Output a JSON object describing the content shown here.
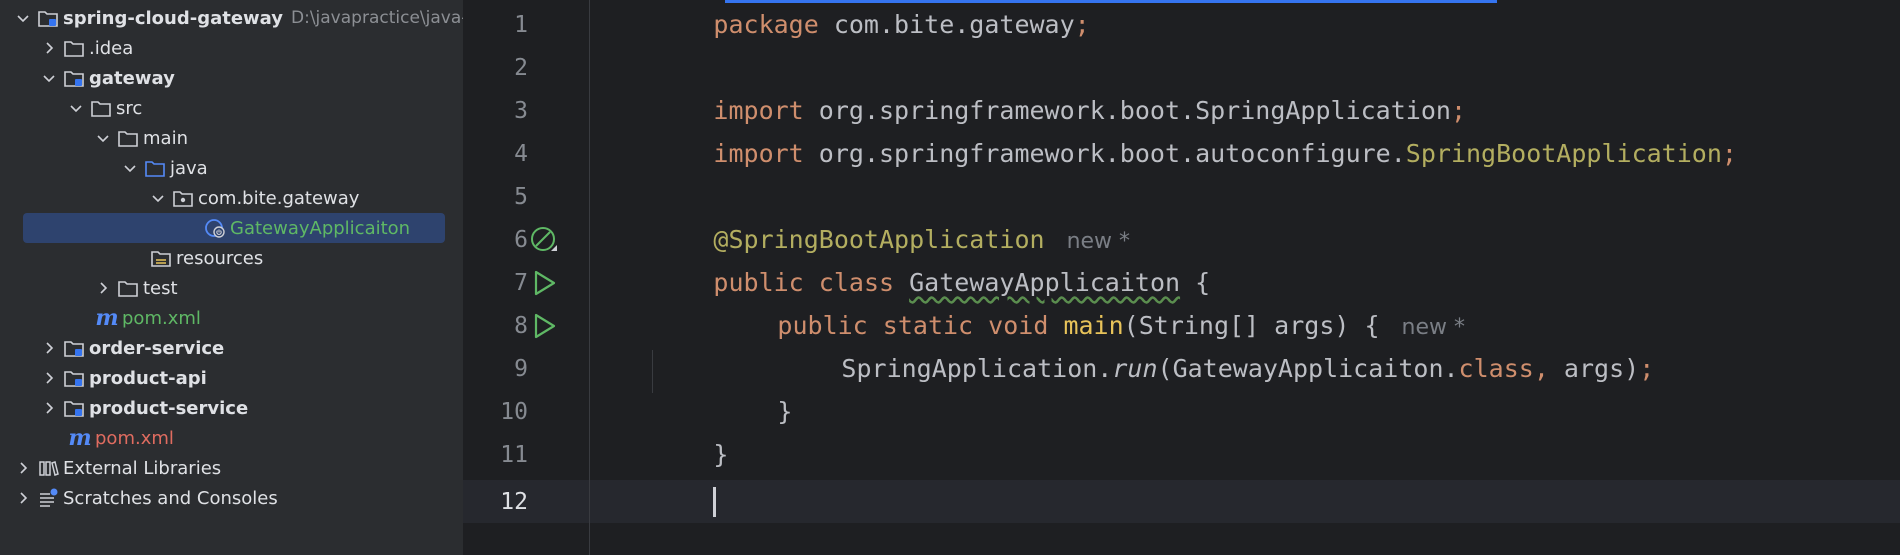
{
  "project_tree": {
    "root": {
      "name": "spring-cloud-gateway",
      "path": "D:\\javapractice\\java-s"
    },
    "items": [
      {
        "label": ".idea"
      },
      {
        "label": "gateway"
      },
      {
        "label": "src"
      },
      {
        "label": "main"
      },
      {
        "label": "java"
      },
      {
        "label": "com.bite.gateway"
      },
      {
        "label": "GatewayApplicaiton"
      },
      {
        "label": "resources"
      },
      {
        "label": "test"
      },
      {
        "label": "pom.xml"
      },
      {
        "label": "order-service"
      },
      {
        "label": "product-api"
      },
      {
        "label": "product-service"
      },
      {
        "label": "pom.xml"
      },
      {
        "label": "External Libraries"
      },
      {
        "label": "Scratches and Consoles"
      }
    ]
  },
  "editor": {
    "line_numbers": [
      "1",
      "2",
      "3",
      "4",
      "5",
      "6",
      "7",
      "8",
      "9",
      "10",
      "11",
      "12"
    ],
    "hint_new": "new *",
    "code": {
      "l1": {
        "kw": "package",
        "rest": " com.bite.gateway",
        "semi": ";"
      },
      "l3": {
        "kw": "import",
        "rest": " org.springframework.boot.SpringApplication",
        "semi": ";"
      },
      "l4": {
        "kw": "import",
        "rest": " org.springframework.boot.autoconfigure.",
        "ann": "SpringBootApplication",
        "semi": ";"
      },
      "l6": {
        "ann": "@SpringBootApplication"
      },
      "l7": {
        "kw1": "public",
        "kw2": "class",
        "name": "GatewayApplicaiton",
        "rest": " {"
      },
      "l8": {
        "kw1": "public",
        "kw2": "static",
        "kw3": "void",
        "fn": "main",
        "rest": "(String[] args) {"
      },
      "l9": {
        "cls": "SpringApplication.",
        "fn": "run",
        "mid": "(GatewayApplicaiton.",
        "kw": "class",
        "comma": ",",
        "rest": " args)",
        "semi": ";"
      },
      "l10": {
        "rest": "}"
      },
      "l11": {
        "rest": "}"
      }
    }
  },
  "colors": {
    "keyword": "#cf8e6d",
    "annotation": "#b3ae60",
    "plain": "#bcbec4",
    "method": "#e8c35a",
    "selection": "#2e436e",
    "accent": "#3574f0"
  }
}
